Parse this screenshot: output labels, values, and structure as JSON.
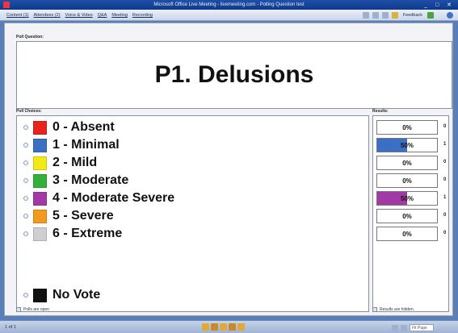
{
  "window": {
    "title": "Microsoft Office Live Meeting - livemeeting.com - Polling Question test"
  },
  "menu": {
    "items": [
      "Content (1)",
      "Attendees (2)",
      "Voice & Video",
      "Q&A",
      "Meeting",
      "Recording"
    ],
    "feedback_label": "Feedback"
  },
  "poll": {
    "question_label": "Poll Question:",
    "question": "P1. Delusions",
    "choices_label": "Poll Choices:",
    "results_label": "Results:",
    "choices": [
      {
        "label": "0 - Absent",
        "color": "#e8231e",
        "percent_text": "0%",
        "percent": 0,
        "count": "0"
      },
      {
        "label": "1 - Minimal",
        "color": "#3a6fc4",
        "percent_text": "50%",
        "percent": 50,
        "count": "1"
      },
      {
        "label": "2 - Mild",
        "color": "#f2ea16",
        "percent_text": "0%",
        "percent": 0,
        "count": "0"
      },
      {
        "label": "3 - Moderate",
        "color": "#34b03a",
        "percent_text": "0%",
        "percent": 0,
        "count": "0"
      },
      {
        "label": "4 - Moderate Severe",
        "color": "#a23aa6",
        "percent_text": "50%",
        "percent": 50,
        "count": "1"
      },
      {
        "label": "5 - Severe",
        "color": "#f39a1e",
        "percent_text": "0%",
        "percent": 0,
        "count": "0"
      },
      {
        "label": "6 - Extreme",
        "color": "#cfcfcf",
        "percent_text": "0%",
        "percent": 0,
        "count": "0"
      }
    ],
    "no_vote": {
      "label": "No Vote",
      "color": "#111111"
    },
    "polls_open_text": "Polls are open",
    "results_hidden_text": "Results are hidden."
  },
  "status": {
    "page": "1 of 1",
    "zoom": "Fit Page"
  },
  "icons": {
    "system": "app-icon",
    "help": "help-icon",
    "lock": "lock-icon"
  }
}
